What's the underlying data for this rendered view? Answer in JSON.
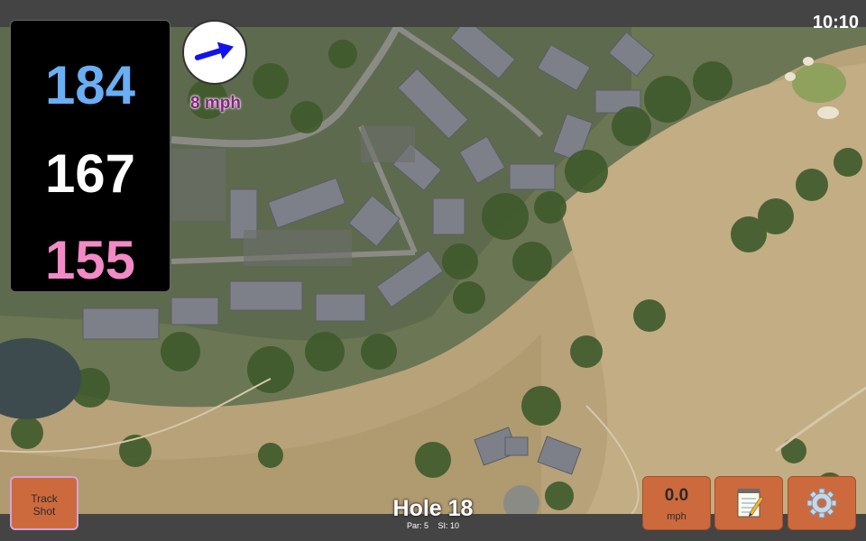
{
  "clock": "10:10",
  "distances": {
    "back": "184",
    "middle": "167",
    "front": "155"
  },
  "colors": {
    "back": "#6aaef4",
    "middle": "#ffffff",
    "front": "#f28ac6",
    "wind_label": "#8a1f86",
    "button": "#cd6a3d"
  },
  "wind": {
    "speed_label": "8 mph",
    "arrow_icon": "wind-direction-arrow-icon"
  },
  "buttons": {
    "track_shot": {
      "line1": "Track",
      "line2": "Shot"
    },
    "wind": {
      "value": "0.0",
      "unit": "mph"
    },
    "notes_icon": "notepad-icon",
    "settings_icon": "gear-icon"
  },
  "hole": {
    "title": "Hole 18",
    "par": "Par: 5",
    "stroke_index": "SI: 10"
  }
}
